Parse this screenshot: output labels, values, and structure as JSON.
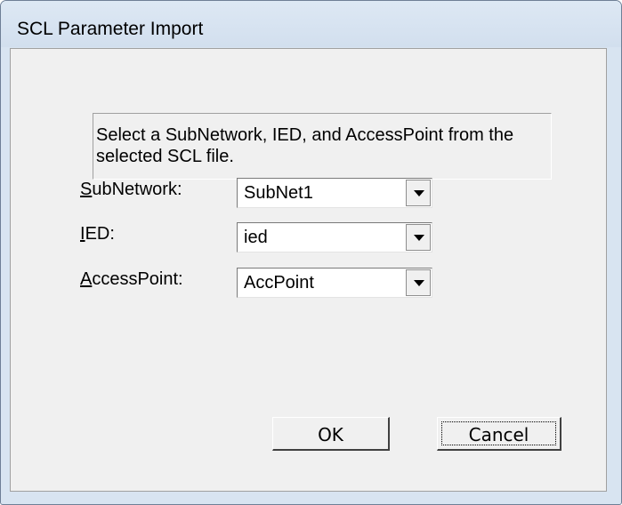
{
  "window": {
    "title": "SCL Parameter Import"
  },
  "info": {
    "text": "Select a SubNetwork, IED, and AccessPoint from the selected SCL file."
  },
  "fields": [
    {
      "label_mnemonic": "S",
      "label_rest": "ubNetwork:",
      "value": "SubNet1"
    },
    {
      "label_mnemonic": "I",
      "label_rest": "ED:",
      "value": "ied"
    },
    {
      "label_mnemonic": "A",
      "label_rest": "ccessPoint:",
      "value": "AccPoint"
    }
  ],
  "buttons": {
    "ok": "OK",
    "cancel": "Cancel"
  },
  "icons": {
    "dropdown": "dropdown-arrow-icon"
  }
}
